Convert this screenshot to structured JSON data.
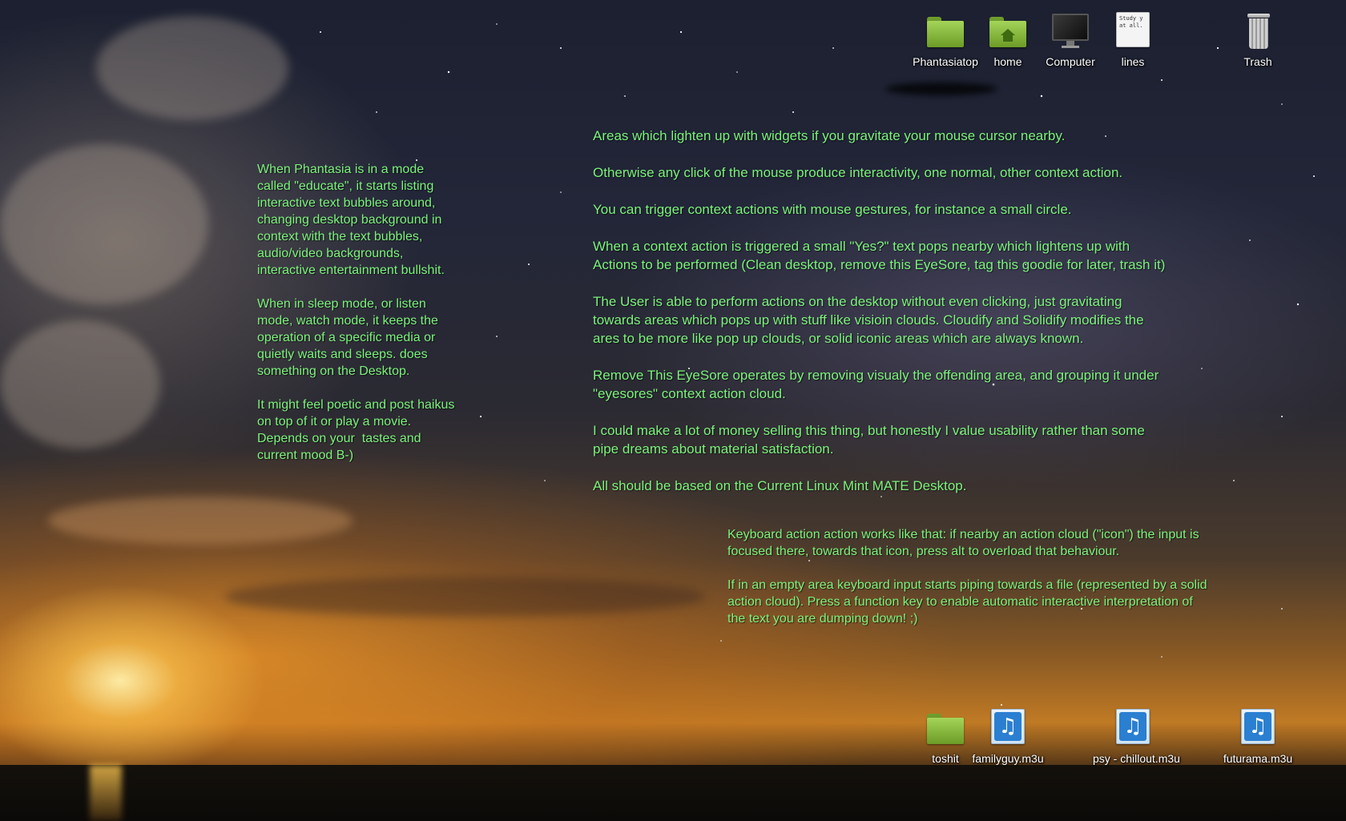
{
  "desktop": {
    "top_icons": [
      {
        "label": "Phantasiatop",
        "icon": "folder-icon"
      },
      {
        "label": "home",
        "icon": "home-folder-icon"
      },
      {
        "label": "Computer",
        "icon": "computer-icon"
      },
      {
        "label": "lines",
        "icon": "text-file-icon",
        "preview": "Study y\nat all."
      },
      {
        "label": "Trash",
        "icon": "trash-icon"
      }
    ],
    "bottom_icons": [
      {
        "label": "toshit",
        "icon": "folder-icon"
      },
      {
        "label": "familyguy.m3u",
        "icon": "audio-playlist-icon"
      },
      {
        "label": "psy - chillout.m3u",
        "icon": "audio-playlist-icon"
      },
      {
        "label": "futurama.m3u",
        "icon": "audio-playlist-icon"
      }
    ]
  },
  "text_bubbles": {
    "left": [
      "When Phantasia is in a mode\ncalled \"educate\", it starts listing\ninteractive text bubbles around,\nchanging desktop background in\ncontext with the text bubbles,\naudio/video backgrounds,\ninteractive entertainment bullshit.",
      "When in sleep mode, or listen\nmode, watch mode, it keeps the\noperation of a specific media or\nquietly waits and sleeps. does\nsomething on the Desktop.",
      "It might feel poetic and post haikus\non top of it or play a movie.\nDepends on your  tastes and\ncurrent mood B-)"
    ],
    "main": [
      "Areas which lighten up with widgets if you gravitate your mouse cursor nearby.",
      "Otherwise any click of the mouse produce interactivity, one normal, other context action.",
      "You can trigger context actions with mouse gestures, for instance a small circle.",
      "When a context action is triggered a small \"Yes?\" text pops nearby which lightens up with\nActions to be performed (Clean desktop, remove this EyeSore, tag this goodie for later, trash it)",
      "The User is able to perform actions on the desktop without even clicking, just gravitating\ntowards areas which pops up with stuff like visioin clouds. Cloudify and Solidify modifies the\nares to be more like pop up clouds, or solid iconic areas which are always known.",
      "Remove This EyeSore operates by removing visualy the offending area, and grouping it under\n\"eyesores\" context action cloud.",
      "I could make a lot of money selling this thing, but honestly I value usability rather than some\npipe dreams about material satisfaction.",
      "All should be based on the Current Linux Mint MATE Desktop."
    ],
    "keyboard": [
      "Keyboard action action works like that: if nearby an action cloud (\"icon\") the input is\nfocused there, towards that icon, press alt to overload that behaviour.",
      "If in an empty area keyboard input starts piping towards a file (represented by a solid\naction cloud). Press a function key to enable automatic interactive interpretation of\nthe text you are dumping down! ;)"
    ]
  },
  "colors": {
    "bubble_text": "#7cf27c",
    "folder_green": "#8dbd3f",
    "audio_blue": "#2a7fd1"
  }
}
